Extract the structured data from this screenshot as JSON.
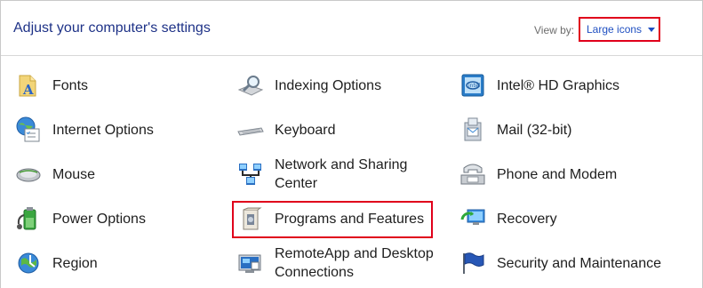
{
  "header": {
    "title": "Adjust your computer's settings",
    "view_by_label": "View by:",
    "view_by_value": "Large icons"
  },
  "items": [
    {
      "label": "Fonts",
      "icon": "fonts-icon"
    },
    {
      "label": "Indexing Options",
      "icon": "indexing-options-icon"
    },
    {
      "label": "Intel® HD Graphics",
      "icon": "intel-hd-graphics-icon"
    },
    {
      "label": "Internet Options",
      "icon": "internet-options-icon"
    },
    {
      "label": "Keyboard",
      "icon": "keyboard-icon"
    },
    {
      "label": "Mail (32-bit)",
      "icon": "mail-icon"
    },
    {
      "label": "Mouse",
      "icon": "mouse-icon"
    },
    {
      "label": "Network and Sharing Center",
      "icon": "network-sharing-icon"
    },
    {
      "label": "Phone and Modem",
      "icon": "phone-modem-icon"
    },
    {
      "label": "Power Options",
      "icon": "power-options-icon"
    },
    {
      "label": "Programs and Features",
      "icon": "programs-features-icon"
    },
    {
      "label": "Recovery",
      "icon": "recovery-icon"
    },
    {
      "label": "Region",
      "icon": "region-icon"
    },
    {
      "label": "RemoteApp and Desktop Connections",
      "icon": "remoteapp-icon"
    },
    {
      "label": "Security and Maintenance",
      "icon": "security-maintenance-icon"
    }
  ],
  "highlight_colors": {
    "frame": "#e0001b",
    "link": "#1f4fc1",
    "title": "#1e3287"
  }
}
